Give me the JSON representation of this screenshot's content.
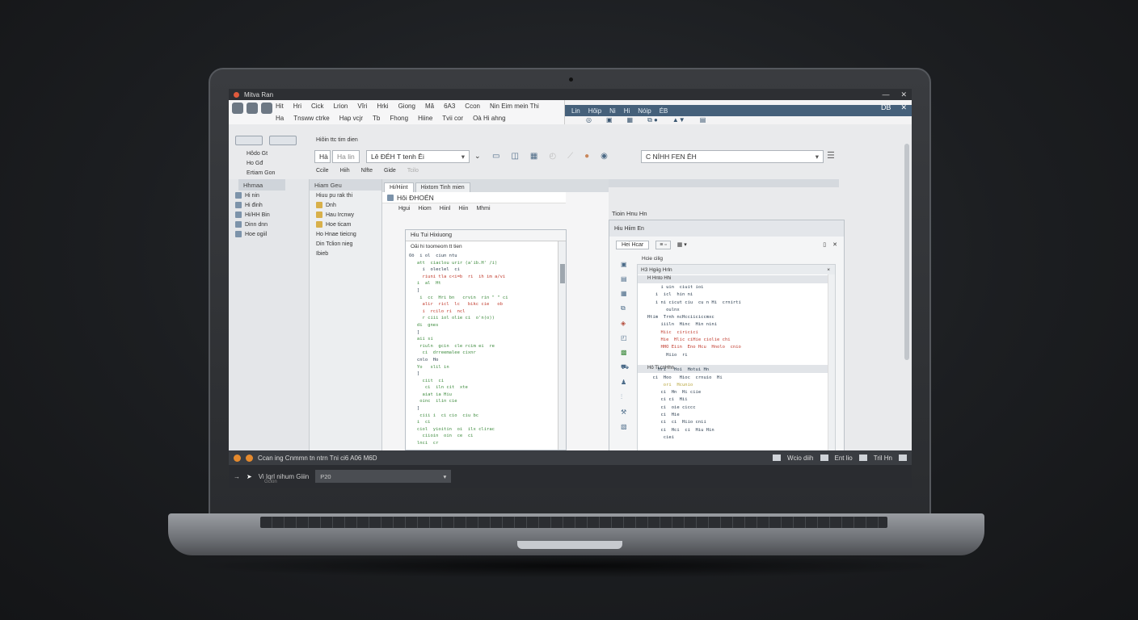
{
  "window": {
    "title": "Mitva Ran",
    "min": "—",
    "close": "✕"
  },
  "ribbon": {
    "tabs_row1": [
      "Hit",
      "Hri",
      "Cick",
      "Lrion",
      "Vîri",
      "Hrki",
      "Giong",
      "Mă",
      "6A3",
      "Ccon",
      "Nin Eim mein Thi"
    ],
    "tabs_row2": [
      "Ha",
      "Tnsww ctrke",
      "Hap vcjr",
      "Tb",
      "Fhong",
      "Hiine",
      "Tvii cor",
      "Oà Hi ahng"
    ],
    "right_tabs": [
      "Lin",
      "Hôip",
      "Ni",
      "Hi",
      "Nóip",
      "ÉB"
    ],
    "right_controls": [
      "DB",
      "✕"
    ]
  },
  "toolbar": {
    "group_title": "Hiôin ttc tim dien",
    "left_items": [
      "Hôdo Gt",
      "Ho Gđ",
      "Ertiam Gon"
    ],
    "btn_ha": "Hà",
    "btn_ra": "Ha lin",
    "combo1": "Lê ÐÉH T tenh Ēi",
    "combo2": "C NÍHH FEN ĒH",
    "sub_items": [
      "Ccile",
      "Hiih",
      "Nlfte",
      "Gide",
      "Tcilo"
    ]
  },
  "left_panel": {
    "tab": "Hhmaa",
    "items": [
      "Hi nin",
      "Hi đinh",
      "Hi/HH Bin",
      "Dinn dnn",
      "Hoe ogiil"
    ]
  },
  "nav_panel": {
    "tab": "Hiam Geu",
    "items": [
      "Hiuu pu rak thi",
      "Dnh",
      "Hau Ircnwy",
      "Hoe ticam",
      "Ho Hnae tieicng",
      "Din Tclion nieg",
      "Ibieb"
    ]
  },
  "document": {
    "tabs": [
      "Hi/Hiint",
      "Hixtom Tinh mien"
    ],
    "title": "Hôi ÐHOÉN",
    "columns": [
      "Hgui",
      "Hiom",
      "Hiinl",
      "Hiin",
      "Mhmi"
    ],
    "code_title": "Hiu Tui Hixiuong",
    "code_sub": "Oăi hi toomeom tt tien",
    "code": [
      {
        "t": "Oõ  i ol  ciun ntu",
        "c": "cb"
      },
      {
        "t": "   att  ciaclou urir (a'ib.H' /i)",
        "c": "cg"
      },
      {
        "t": "     i  oleclel  ci",
        "c": "cb"
      },
      {
        "t": "     riuni tla c<i=b  ri  ih im a/vi",
        "c": "cr"
      },
      {
        "t": "   i  al  Ht",
        "c": "cg"
      },
      {
        "t": "   ]",
        "c": "cb"
      },
      {
        "t": "    i  cc  Hri bn   crvin  rin \" \" ci",
        "c": "cg"
      },
      {
        "t": "     alir  ricl  lc   bikc cie   ob",
        "c": "cr"
      },
      {
        "t": "     i  rcilo ri  ncl",
        "c": "cr"
      },
      {
        "t": "     r ciii iol olie ci  o'n(o))",
        "c": "cg"
      },
      {
        "t": "   di  gnes",
        "c": "cg"
      },
      {
        "t": "   ]",
        "c": "cb"
      },
      {
        "t": "   aii si",
        "c": "cg"
      },
      {
        "t": "    riuln  gcin  cle rcim ei  re",
        "c": "cg"
      },
      {
        "t": "     ci  drreemalee cixnr",
        "c": "cg"
      },
      {
        "t": "   cnlo  Ho",
        "c": "cb"
      },
      {
        "t": "   Yo   slil in",
        "c": "cg"
      },
      {
        "t": "   ]",
        "c": "cb"
      },
      {
        "t": "     ciit  ci",
        "c": "cg"
      },
      {
        "t": "      ci  iln cit  xte",
        "c": "cg"
      },
      {
        "t": "     aiat ia Hiu",
        "c": "cg"
      },
      {
        "t": "    oinc  ilin cie",
        "c": "cg"
      },
      {
        "t": "   ]",
        "c": "cb"
      },
      {
        "t": "    ciii i  ci cio  ciu bc",
        "c": "cg"
      },
      {
        "t": "   i  ci",
        "c": "cg"
      },
      {
        "t": "   ciol  yioitin  oi  ilx clirac",
        "c": "cg"
      },
      {
        "t": "     ciioin  oin  ce  ci",
        "c": "cg"
      },
      {
        "t": "   lnci  cr",
        "c": "cg"
      }
    ]
  },
  "right_panel": {
    "title": "Tioin  Hnu  Hn",
    "head": "Hiu Hiim En",
    "btn": "Hei Hcar",
    "sub_head": "Hcie  cilig",
    "inner_hdr": "H3 Hgiig Hrln",
    "section1": "H  Hnto Hhi",
    "section2": "Hô  Ti cnHhn",
    "lines": [
      {
        "t": "        i uin  ciuit ioi",
        "c": "cb"
      },
      {
        "t": "      i  icl  hin ni",
        "c": "cb"
      },
      {
        "t": "      i ni cicut ciu  cu n Hi  crnirti",
        "c": "cb"
      },
      {
        "t": "          oulnx",
        "c": "cb"
      },
      {
        "t": "   Htim  Trnh ncHcciiciccmxc",
        "c": "cb"
      },
      {
        "t": "        iiiln  Hinc  Hin nini",
        "c": "cb"
      },
      {
        "t": "        Hiic  ciricici",
        "c": "cr"
      },
      {
        "t": "        Hie  Hlic ciHie ciolie chi",
        "c": "cr"
      },
      {
        "t": "        HHO Eiin  Eno Hcu  Hnolo  cnio",
        "c": "cr"
      },
      {
        "t": "          Hiio  ri",
        "c": "cb"
      },
      {
        "t": "",
        "c": "cb"
      },
      {
        "t": "       Hri   Hoi  Hotui Hn",
        "c": "cb"
      },
      {
        "t": "     ci  Hoo   Hioc  crnuio  Hi",
        "c": "cb"
      },
      {
        "t": "         ori  Hcunio",
        "c": "cy"
      },
      {
        "t": "        ci  Hn  Hi ciie",
        "c": "cb"
      },
      {
        "t": "        ci ci  Hii",
        "c": "cb"
      },
      {
        "t": "        ci  oie ciccc",
        "c": "cb"
      },
      {
        "t": "        ci  Hie",
        "c": "cb"
      },
      {
        "t": "        ci  ci  Hiio cnii",
        "c": "cb"
      },
      {
        "t": "        ci  Hci  ci  Hiu Hin",
        "c": "cb"
      },
      {
        "t": "         ciei  ",
        "c": "cb"
      }
    ]
  },
  "statusbar": {
    "text": "Ccan ing Cnmmn tn ntrn Tni ci6 A06 M6D",
    "right": [
      "Wcio diih",
      "Ent lio",
      "Tril Hn"
    ]
  },
  "cmdbar": {
    "label": "Vi Iqrl nihum  Giiin",
    "sub": "Gcion",
    "field": "P20"
  }
}
